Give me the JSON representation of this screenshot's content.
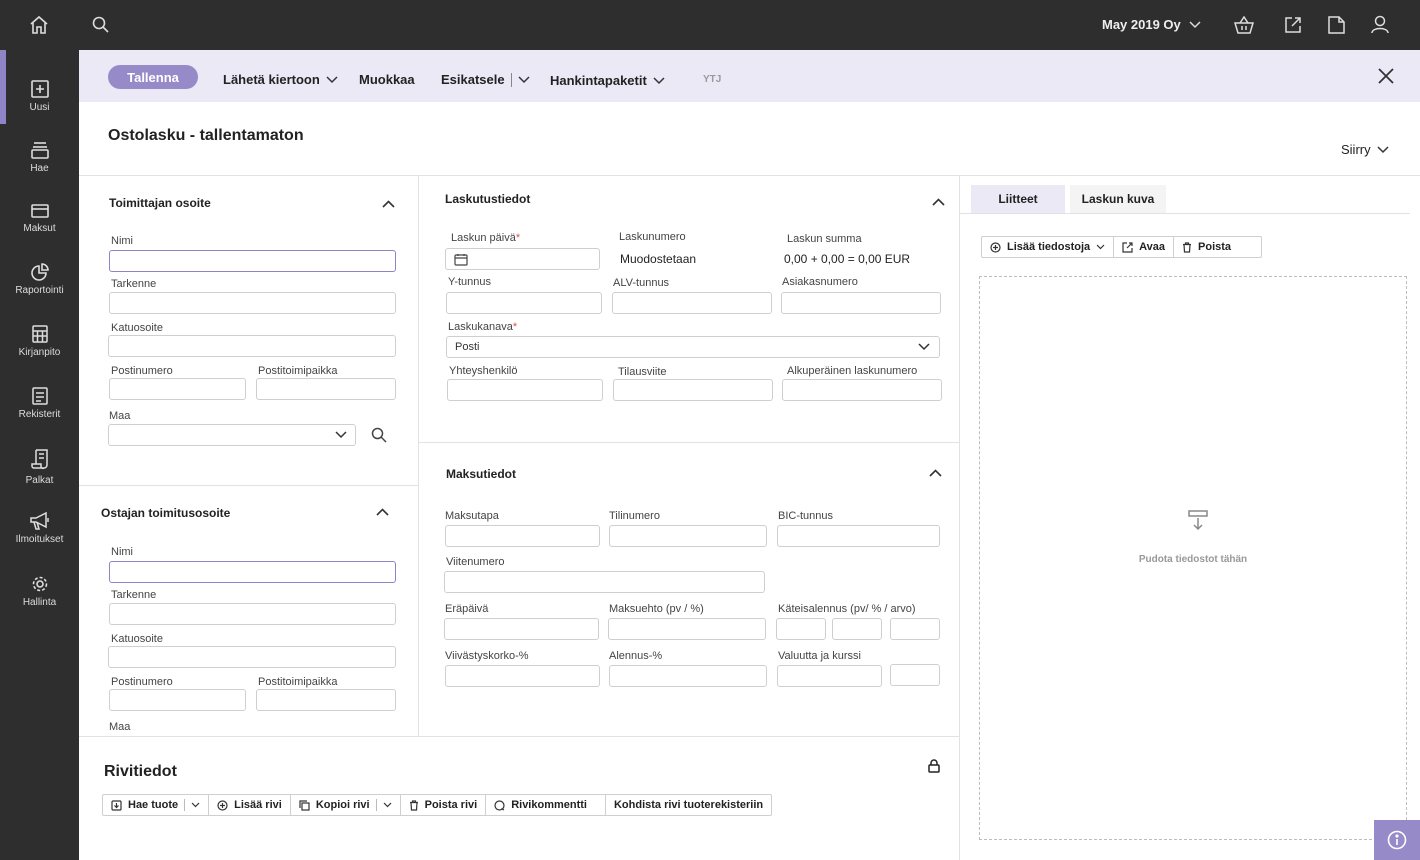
{
  "topbar": {
    "company": "May 2019 Oy",
    "icons": [
      "home-icon",
      "search-icon",
      "basket-icon",
      "external-link-icon",
      "document-icon",
      "user-icon"
    ]
  },
  "sidenav": {
    "items": [
      {
        "label": "Uusi",
        "icon": "plus-square-icon"
      },
      {
        "label": "Hae",
        "icon": "stack-icon"
      },
      {
        "label": "Maksut",
        "icon": "card-icon"
      },
      {
        "label": "Raportointi",
        "icon": "pie-chart-icon"
      },
      {
        "label": "Kirjanpito",
        "icon": "calculator-icon"
      },
      {
        "label": "Rekisterit",
        "icon": "register-icon"
      },
      {
        "label": "Palkat",
        "icon": "scroll-icon"
      },
      {
        "label": "Ilmoitukset",
        "icon": "megaphone-icon"
      },
      {
        "label": "Hallinta",
        "icon": "gear-icon"
      }
    ]
  },
  "toolbar": {
    "save": "Tallenna",
    "send": "Lähetä kiertoon",
    "edit": "Muokkaa",
    "preview": "Esikatsele",
    "packages": "Hankintapaketit",
    "ytj": "YTJ"
  },
  "page": {
    "title": "Ostolasku - tallentamaton",
    "goto": "Siirry"
  },
  "supplier": {
    "title": "Toimittajan osoite",
    "name": "Nimi",
    "spec": "Tarkenne",
    "street": "Katuosoite",
    "postcode": "Postinumero",
    "city": "Postitoimipaikka",
    "country": "Maa"
  },
  "buyer": {
    "title": "Ostajan toimitusosoite",
    "name": "Nimi",
    "spec": "Tarkenne",
    "street": "Katuosoite",
    "postcode": "Postinumero",
    "city": "Postitoimipaikka",
    "country": "Maa"
  },
  "billing": {
    "title": "Laskutustiedot",
    "invoice_date": "Laskun päivä",
    "invoice_number": "Laskunumero",
    "invoice_number_value": "Muodostetaan",
    "invoice_sum": "Laskun summa",
    "invoice_sum_value": "0,00 + 0,00 = 0,00 EUR",
    "business_id": "Y-tunnus",
    "vat_id": "ALV-tunnus",
    "customer_number": "Asiakasnumero",
    "channel": "Laskukanava",
    "channel_value": "Posti",
    "contact": "Yhteyshenkilö",
    "order_ref": "Tilausviite",
    "original_number": "Alkuperäinen laskunumero"
  },
  "payment": {
    "title": "Maksutiedot",
    "method": "Maksutapa",
    "account": "Tilinumero",
    "bic": "BIC-tunnus",
    "reference": "Viitenumero",
    "due_date": "Eräpäivä",
    "terms": "Maksuehto (pv / %)",
    "cash_discount": "Käteisalennus (pv/ % / arvo)",
    "penalty": "Viivästyskorko-%",
    "discount": "Alennus-%",
    "currency": "Valuutta ja kurssi"
  },
  "attachments": {
    "tab_attachments": "Liitteet",
    "tab_image": "Laskun kuva",
    "add": "Lisää tiedostoja",
    "open": "Avaa",
    "delete": "Poista",
    "drop": "Pudota tiedostot tähän"
  },
  "rows": {
    "title": "Rivitiedot",
    "fetch": "Hae tuote",
    "add": "Lisää rivi",
    "copy": "Kopioi rivi",
    "delete": "Poista rivi",
    "comment": "Rivikommentti",
    "assign": "Kohdista rivi tuoterekisteriin"
  },
  "colors": {
    "accent": "#968bc8",
    "toolbar_bg": "#ece9f6",
    "nav_bg": "#2e2e2e"
  }
}
